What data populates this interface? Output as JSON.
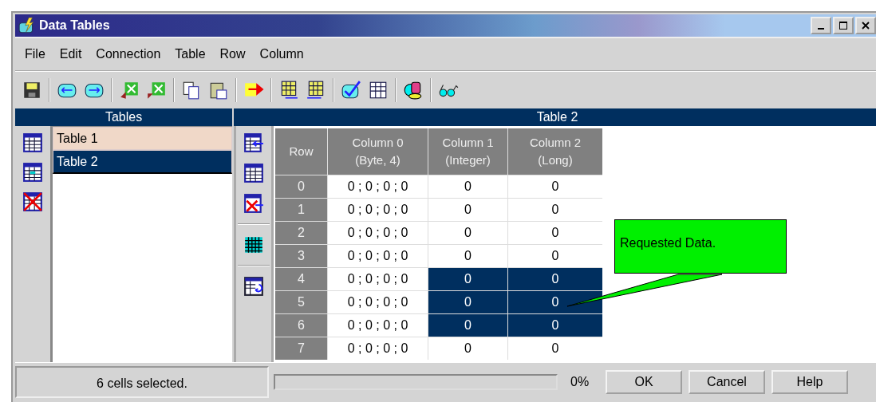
{
  "window": {
    "title": "Data Tables"
  },
  "menu": [
    "File",
    "Edit",
    "Connection",
    "Table",
    "Row",
    "Column"
  ],
  "tables_panel": {
    "header": "Tables",
    "items": [
      {
        "label": "Table 1",
        "selected": false
      },
      {
        "label": "Table 2",
        "selected": true
      }
    ]
  },
  "grid": {
    "header": "Table 2",
    "row_header": "Row",
    "columns": [
      {
        "name": "Column 0",
        "type": "(Byte, 4)"
      },
      {
        "name": "Column 1",
        "type": "(Integer)"
      },
      {
        "name": "Column 2",
        "type": "(Long)"
      }
    ],
    "rows": [
      {
        "row": "0",
        "cells": [
          {
            "text": "0 ; 0 ; 0 ; 0",
            "selected": false
          },
          {
            "text": "0",
            "selected": false
          },
          {
            "text": "0",
            "selected": false
          }
        ]
      },
      {
        "row": "1",
        "cells": [
          {
            "text": "0 ; 0 ; 0 ; 0",
            "selected": false
          },
          {
            "text": "0",
            "selected": false
          },
          {
            "text": "0",
            "selected": false
          }
        ]
      },
      {
        "row": "2",
        "cells": [
          {
            "text": "0 ; 0 ; 0 ; 0",
            "selected": false
          },
          {
            "text": "0",
            "selected": false
          },
          {
            "text": "0",
            "selected": false
          }
        ]
      },
      {
        "row": "3",
        "cells": [
          {
            "text": "0 ; 0 ; 0 ; 0",
            "selected": false
          },
          {
            "text": "0",
            "selected": false
          },
          {
            "text": "0",
            "selected": false
          }
        ]
      },
      {
        "row": "4",
        "cells": [
          {
            "text": "0 ; 0 ; 0 ; 0",
            "selected": false
          },
          {
            "text": "0",
            "selected": true
          },
          {
            "text": "0",
            "selected": true
          }
        ]
      },
      {
        "row": "5",
        "cells": [
          {
            "text": "0 ; 0 ; 0 ; 0",
            "selected": false
          },
          {
            "text": "0",
            "selected": true
          },
          {
            "text": "0",
            "selected": true
          }
        ]
      },
      {
        "row": "6",
        "cells": [
          {
            "text": "0 ; 0 ; 0 ; 0",
            "selected": false
          },
          {
            "text": "0",
            "selected": true
          },
          {
            "text": "0",
            "selected": true
          }
        ]
      },
      {
        "row": "7",
        "cells": [
          {
            "text": "0 ; 0 ; 0 ; 0",
            "selected": false
          },
          {
            "text": "0",
            "selected": false
          },
          {
            "text": "0",
            "selected": false
          }
        ]
      }
    ],
    "callout": "Requested Data."
  },
  "status_bar": {
    "message": "6 cells selected.",
    "progress": {
      "level": 0,
      "reading": "0%"
    },
    "buttons": [
      "OK",
      "Cancel",
      "Help"
    ]
  }
}
